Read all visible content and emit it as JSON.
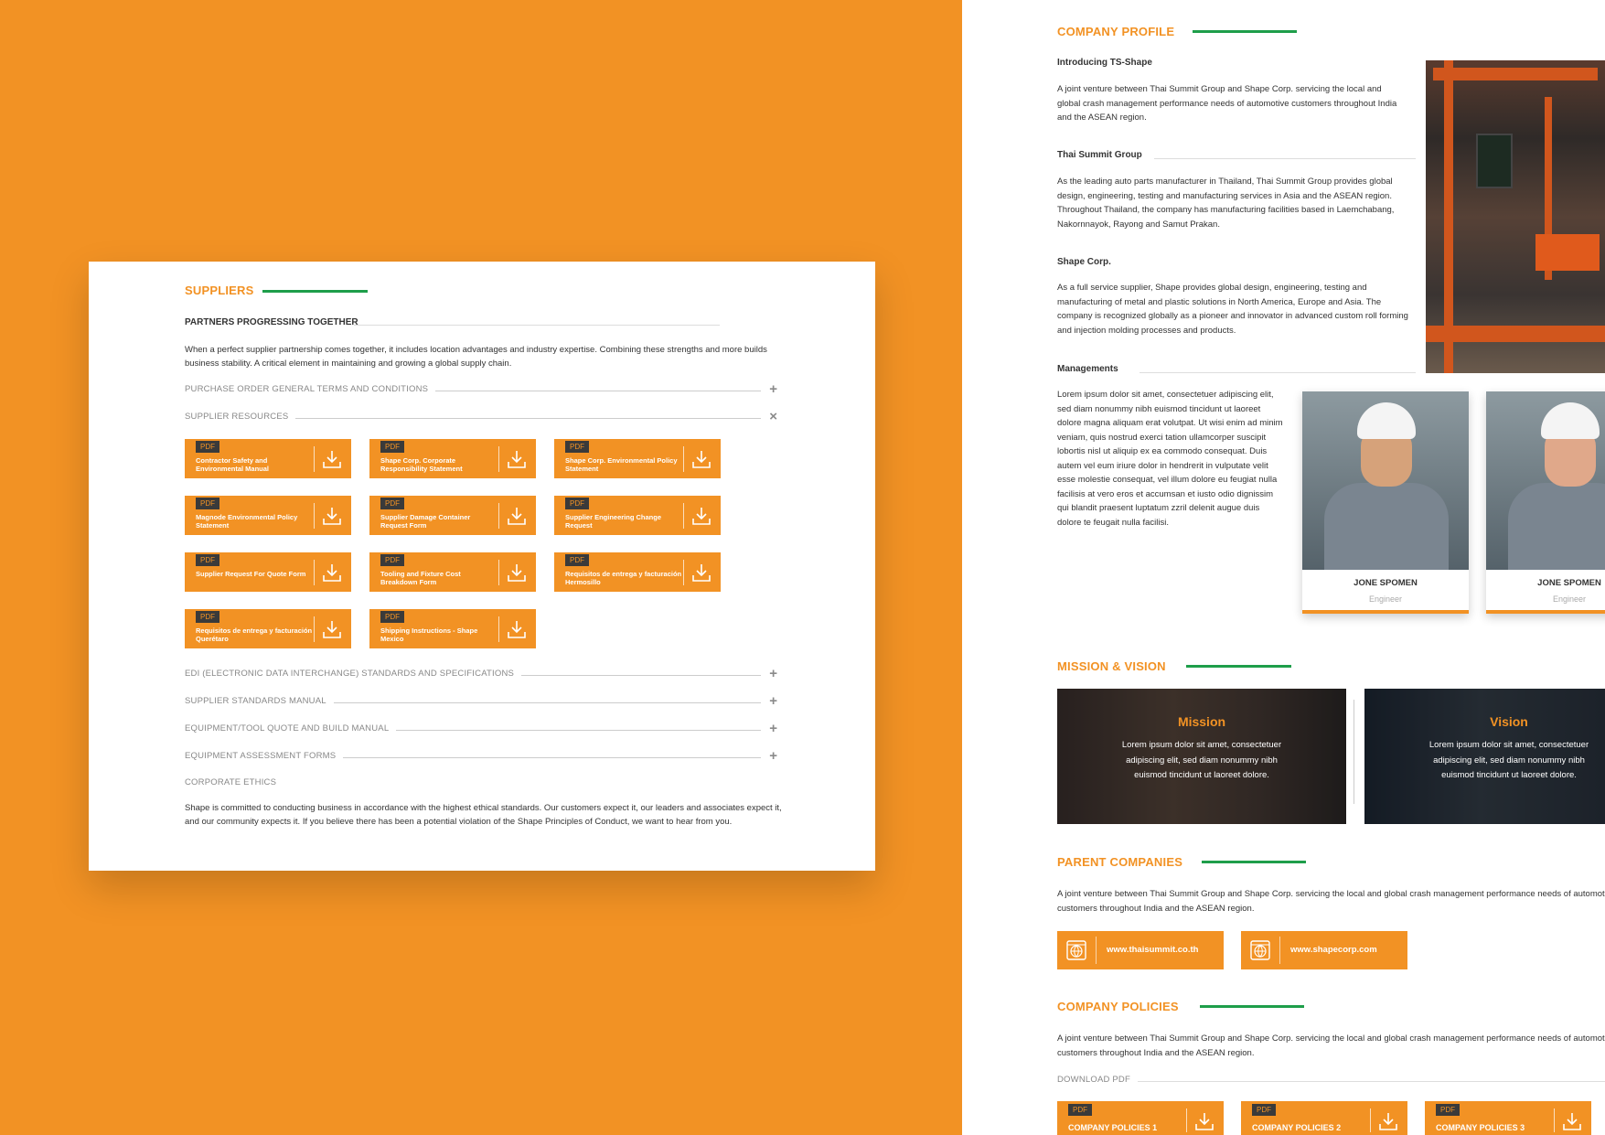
{
  "colors": {
    "accent": "#F29224",
    "green": "#1E9E4A",
    "dark": "#3A3A3A"
  },
  "suppliers": {
    "title": "SUPPLIERS",
    "subtitle": "PARTNERS PROGRESSING TOGETHER",
    "intro": "When a perfect supplier partnership comes together, it includes location advantages and industry expertise. Combining these strengths and more builds business stability. A critical element in maintaining and growing a global supply chain.",
    "accordion_top": [
      {
        "label": "PURCHASE ORDER GENERAL TERMS AND CONDITIONS",
        "symbol": "+"
      },
      {
        "label": "SUPPLIER RESOURCES",
        "symbol": "×"
      }
    ],
    "pdf_badge": "PDF",
    "downloads": [
      "Contractor Safety and Environmental Manual",
      "Shape Corp. Corporate Responsibility Statement",
      "Shape Corp. Environmental Policy Statement",
      "Magnode Environmental Policy Statement",
      "Supplier Damage Container Request Form",
      "Supplier Engineering Change Request",
      "Supplier Request For Quote Form",
      "Tooling and Fixture Cost Breakdown Form",
      "Requisitos de entrega y facturación Hermosillo",
      "Requisitos de entrega y facturación Querétaro",
      "Shipping Instructions - Shape Mexico"
    ],
    "accordion_bottom": [
      {
        "label": "EDI (ELECTRONIC DATA INTERCHANGE) STANDARDS AND SPECIFICATIONS",
        "symbol": "+"
      },
      {
        "label": "SUPPLIER STANDARDS MANUAL",
        "symbol": "+"
      },
      {
        "label": "EQUIPMENT/TOOL QUOTE AND BUILD MANUAL",
        "symbol": "+"
      },
      {
        "label": "EQUIPMENT ASSESSMENT FORMS",
        "symbol": "+"
      }
    ],
    "ethics_title": "CORPORATE ETHICS",
    "ethics_text": "Shape is committed to conducting business in accordance with the highest ethical standards. Our customers expect it, our leaders and associates expect it, and our community expects it. If you believe there has been a potential violation of the Shape Principles of Conduct, we want to hear from you."
  },
  "profile": {
    "title": "COMPANY PROFILE",
    "intro_head": "Introducing TS-Shape",
    "intro_text": "A joint venture between Thai Summit Group and Shape Corp. servicing the local and global crash management performance needs of automotive customers throughout India and the ASEAN region.",
    "thai_head": "Thai Summit Group",
    "thai_text": "As the leading auto parts manufacturer in Thailand, Thai Summit Group provides global design, engineering, testing and manufacturing services in Asia and the ASEAN region. Throughout Thailand, the company has manufacturing facilities based in Laemchabang, Nakornnayok, Rayong and Samut Prakan.",
    "shape_head": "Shape Corp.",
    "shape_text": "As a full service supplier, Shape provides global design, engineering, testing and manufacturing of metal and plastic solutions in North America, Europe and Asia. The company is recognized globally as a pioneer and innovator in advanced custom roll forming and injection molding processes and products.",
    "man_head": "Managements",
    "man_text": "Lorem ipsum dolor sit amet, consectetuer adipiscing elit, sed diam nonummy nibh euismod tincidunt ut laoreet dolore magna aliquam erat volutpat. Ut wisi enim ad minim veniam, quis nostrud exerci tation ullamcorper suscipit lobortis nisl ut aliquip ex ea commodo consequat. Duis autem vel eum iriure dolor in hendrerit in vulputate velit esse molestie consequat, vel illum dolore eu feugiat nulla facilisis at vero eros et accumsan et iusto odio dignissim qui blandit praesent luptatum zzril delenit augue duis dolore te feugait nulla facilisi.",
    "people": [
      {
        "name": "JONE SPOMEN",
        "role": "Engineer"
      },
      {
        "name": "JONE SPOMEN",
        "role": "Engineer"
      }
    ]
  },
  "mission": {
    "title": "MISSION & VISION",
    "mission_head": "Mission",
    "mission_text": "Lorem ipsum dolor sit amet, consectetuer adipiscing elit, sed diam nonummy nibh euismod tincidunt ut laoreet dolore.",
    "vision_head": "Vision",
    "vision_text": "Lorem ipsum dolor sit amet, consectetuer adipiscing elit, sed diam nonummy nibh euismod tincidunt ut laoreet dolore."
  },
  "parents": {
    "title": "PARENT COMPANIES",
    "text": "A joint venture between Thai Summit Group and Shape Corp. servicing the local and global crash management performance needs of automotive customers throughout India and the ASEAN region.",
    "sites": [
      "www.thaisummit.co.th",
      "www.shapecorp.com"
    ]
  },
  "policies": {
    "title": "COMPANY POLICIES",
    "text": "A joint venture between Thai Summit Group and Shape Corp. servicing the local and global crash management performance needs of automotive customers throughout India and the ASEAN region.",
    "download_label": "DOWNLOAD PDF",
    "pdf_badge": "PDF",
    "items": [
      "COMPANY POLICIES 1",
      "COMPANY POLICIES 2",
      "COMPANY POLICIES 3"
    ]
  }
}
